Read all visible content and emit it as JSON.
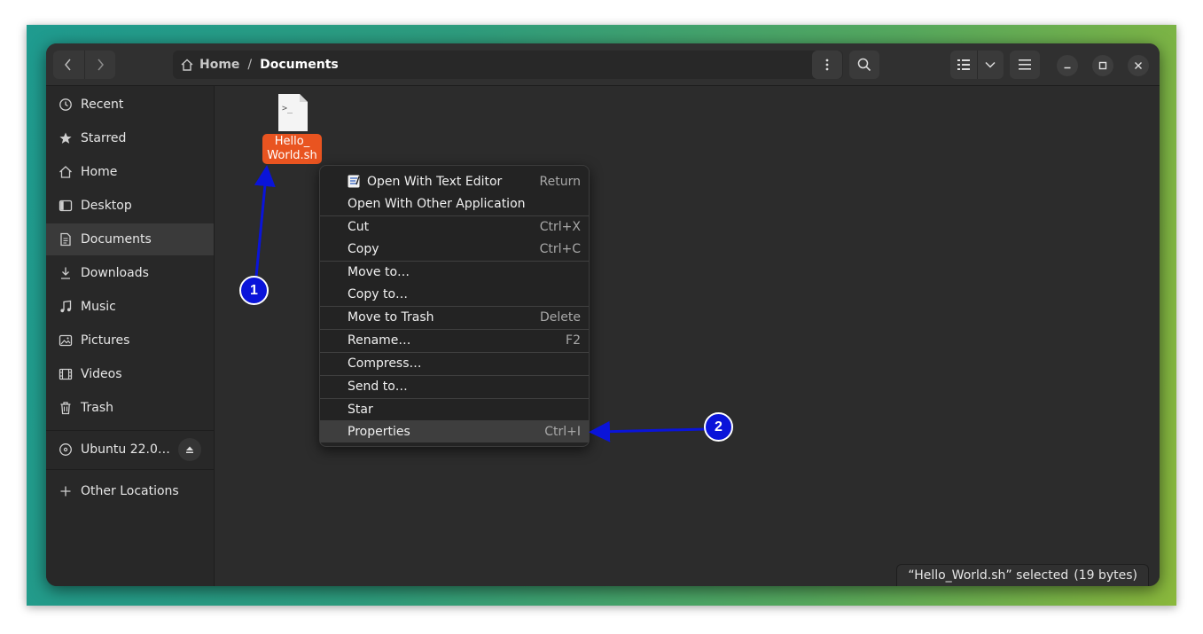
{
  "path": {
    "home": "Home",
    "separator": "/",
    "current": "Documents"
  },
  "sidebar": {
    "items": [
      {
        "label": "Recent",
        "icon": "clock-icon"
      },
      {
        "label": "Starred",
        "icon": "star-icon"
      },
      {
        "label": "Home",
        "icon": "home-icon"
      },
      {
        "label": "Desktop",
        "icon": "desktop-icon"
      },
      {
        "label": "Documents",
        "icon": "document-icon",
        "active": true
      },
      {
        "label": "Downloads",
        "icon": "download-icon"
      },
      {
        "label": "Music",
        "icon": "music-icon"
      },
      {
        "label": "Pictures",
        "icon": "picture-icon"
      },
      {
        "label": "Videos",
        "icon": "video-icon"
      },
      {
        "label": "Trash",
        "icon": "trash-icon"
      }
    ],
    "drive": {
      "label": "Ubuntu 22.0…",
      "icon": "disc-icon"
    },
    "other_locations": "Other Locations"
  },
  "file": {
    "name_line1": "Hello_",
    "name_line2": "World.sh",
    "icon_text": ">_"
  },
  "context_menu": {
    "items": [
      {
        "label": "Open With Text Editor",
        "accel": "Return",
        "icon": "text-editor-icon"
      },
      {
        "label": "Open With Other Application",
        "accel": ""
      },
      {
        "label": "Cut",
        "accel": "Ctrl+X"
      },
      {
        "label": "Copy",
        "accel": "Ctrl+C"
      },
      {
        "label": "Move to…",
        "accel": ""
      },
      {
        "label": "Copy to…",
        "accel": ""
      },
      {
        "label": "Move to Trash",
        "accel": "Delete"
      },
      {
        "label": "Rename…",
        "accel": "F2"
      },
      {
        "label": "Compress…",
        "accel": ""
      },
      {
        "label": "Send to…",
        "accel": ""
      },
      {
        "label": "Star",
        "accel": ""
      },
      {
        "label": "Properties",
        "accel": "Ctrl+I",
        "highlighted": true
      }
    ]
  },
  "status": {
    "selected": "“Hello_World.sh” selected",
    "size": "(19 bytes)"
  },
  "annotations": {
    "badge1": "1",
    "badge2": "2"
  },
  "colors": {
    "accent": "#e95420",
    "annotation": "#0a14d9"
  }
}
